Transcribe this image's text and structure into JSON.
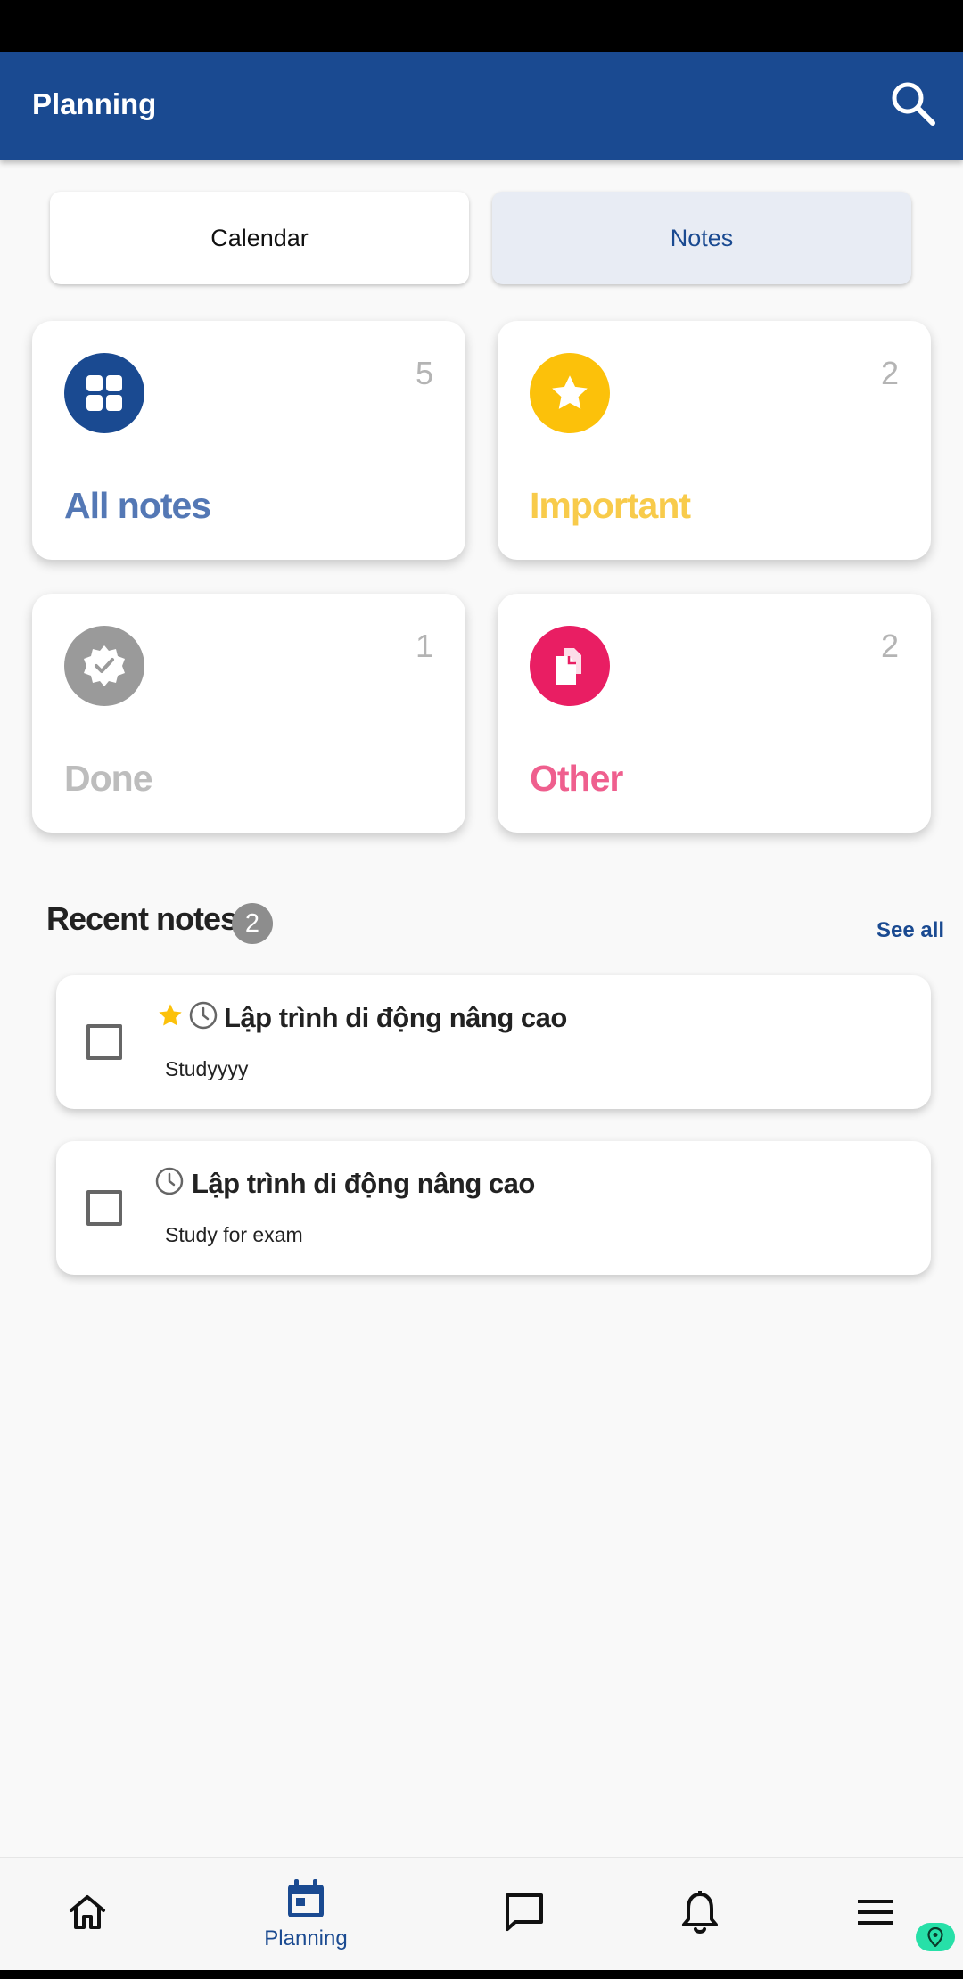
{
  "app_bar": {
    "title": "Planning",
    "search_icon": "search-icon"
  },
  "segments": {
    "calendar": "Calendar",
    "notes": "Notes",
    "selected": "Notes"
  },
  "categories": [
    {
      "label": "All notes",
      "count": "5",
      "icon": "grid-icon",
      "color": "#1a4a91",
      "label_color": "#5478b5"
    },
    {
      "label": "Important",
      "count": "2",
      "icon": "star-icon",
      "color": "#fcc10a",
      "label_color": "#f8cb4b"
    },
    {
      "label": "Done",
      "count": "1",
      "icon": "verified-badge-icon",
      "color": "#9a9a9a",
      "label_color": "#bdbdbd"
    },
    {
      "label": "Other",
      "count": "2",
      "icon": "files-icon",
      "color": "#e91e63",
      "label_color": "#ef5f8e"
    }
  ],
  "recent": {
    "title": "Recent notes",
    "count": "2",
    "see_all": "See all",
    "notes": [
      {
        "title": "Lập trình di động nâng cao",
        "description": "Studyyyy",
        "important": true,
        "has_reminder": true,
        "checked": false
      },
      {
        "title": "Lập trình di động nâng cao",
        "description": "Study for exam",
        "important": false,
        "has_reminder": true,
        "checked": false
      }
    ]
  },
  "bottom_nav": {
    "items": [
      {
        "icon": "home-icon",
        "label": ""
      },
      {
        "icon": "calendar-icon",
        "label": "Planning",
        "active": true
      },
      {
        "icon": "chat-icon",
        "label": ""
      },
      {
        "icon": "bell-icon",
        "label": ""
      },
      {
        "icon": "menu-icon",
        "label": ""
      }
    ]
  },
  "colors": {
    "primary": "#1a4a91",
    "background": "#f9f9f9",
    "accent_badge": "#27e0a8"
  }
}
